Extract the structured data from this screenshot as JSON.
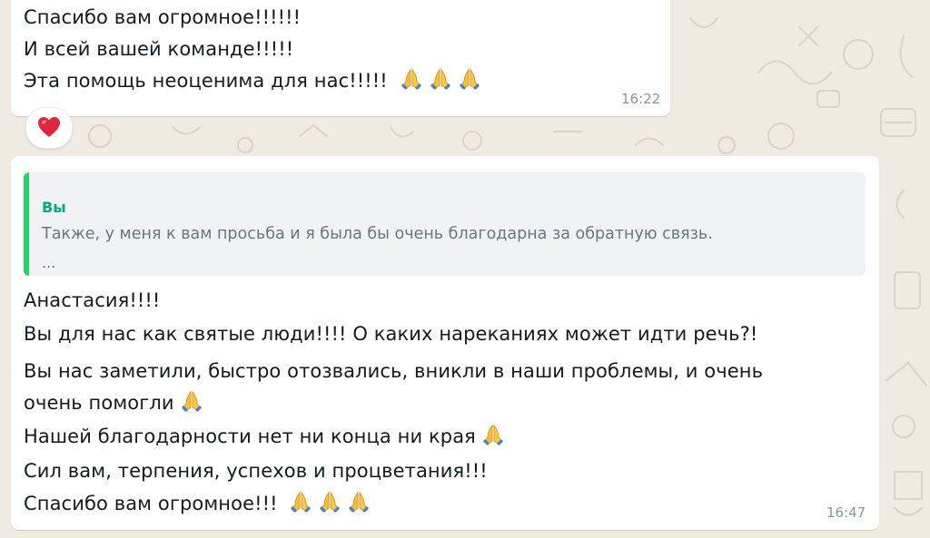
{
  "theme": {
    "background": "#efeae2",
    "bubble": "#ffffff",
    "quote_accent": "#25d366",
    "quote_author_color": "#06a884",
    "timestamp_color": "#8696a0"
  },
  "messages": [
    {
      "lines": [
        "Спасибо вам огромное!!!!!!",
        "И всей вашей команде!!!!!",
        "Эта помощь неоценима для нас!!!!!"
      ],
      "trailing_emoji": [
        "folded-hands",
        "folded-hands",
        "folded-hands"
      ],
      "time": "16:22",
      "reaction": "heart"
    },
    {
      "quote": {
        "author": "Вы",
        "text": "Также, у меня к вам просьба и я была бы очень благодарна за обратную связь.",
        "more": "..."
      },
      "lines": [
        "Анастасия!!!!",
        "Вы для нас как святые люди!!!! О каких нареканиях может идти речь?!",
        "Вы нас заметили, быстро отозвались, вникли в наши проблемы, и очень",
        "очень помогли",
        "Нашей благодарности нет ни конца ни края",
        "Сил вам, терпения, успехов и процветания!!!",
        "Спасибо вам огромное!!!"
      ],
      "time": "16:47"
    }
  ]
}
